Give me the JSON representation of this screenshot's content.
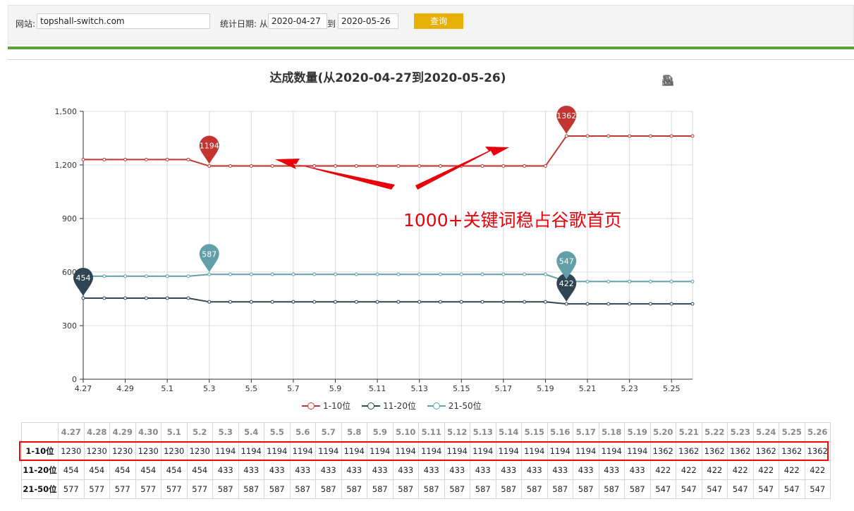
{
  "filter": {
    "site_label": "网站:",
    "site_value": "topshall-switch.com",
    "date_label": "统计日期: 从",
    "date_from": "2020-04-27",
    "to_label": "到",
    "date_to": "2020-05-26",
    "query_label": "查询"
  },
  "annotation_text": "1000+关键词稳占谷歌首页",
  "chart_data": {
    "type": "line",
    "title": "达成数量(从2020-04-27到2020-05-26)",
    "x": [
      "4.27",
      "4.28",
      "4.29",
      "4.30",
      "5.1",
      "5.2",
      "5.3",
      "5.4",
      "5.5",
      "5.6",
      "5.7",
      "5.8",
      "5.9",
      "5.10",
      "5.11",
      "5.12",
      "5.13",
      "5.14",
      "5.15",
      "5.16",
      "5.17",
      "5.18",
      "5.19",
      "5.20",
      "5.21",
      "5.22",
      "5.23",
      "5.24",
      "5.25",
      "5.26"
    ],
    "x_tick_labels": [
      "4.27",
      "4.29",
      "5.1",
      "5.3",
      "5.5",
      "5.7",
      "5.9",
      "5.11",
      "5.13",
      "5.15",
      "5.17",
      "5.19",
      "5.21",
      "5.23",
      "5.25"
    ],
    "y_ticks": [
      "0",
      "300",
      "600",
      "900",
      "1,200",
      "1,500"
    ],
    "ylim": [
      0,
      1500
    ],
    "series": [
      {
        "name": "1-10位",
        "color": "#c23531",
        "values": [
          1230,
          1230,
          1230,
          1230,
          1230,
          1230,
          1194,
          1194,
          1194,
          1194,
          1194,
          1194,
          1194,
          1194,
          1194,
          1194,
          1194,
          1194,
          1194,
          1194,
          1194,
          1194,
          1194,
          1362,
          1362,
          1362,
          1362,
          1362,
          1362,
          1362
        ]
      },
      {
        "name": "11-20位",
        "color": "#2f4554",
        "values": [
          454,
          454,
          454,
          454,
          454,
          454,
          433,
          433,
          433,
          433,
          433,
          433,
          433,
          433,
          433,
          433,
          433,
          433,
          433,
          433,
          433,
          433,
          433,
          422,
          422,
          422,
          422,
          422,
          422,
          422
        ]
      },
      {
        "name": "21-50位",
        "color": "#61a0a8",
        "values": [
          577,
          577,
          577,
          577,
          577,
          577,
          587,
          587,
          587,
          587,
          587,
          587,
          587,
          587,
          587,
          587,
          587,
          587,
          587,
          587,
          587,
          587,
          587,
          547,
          547,
          547,
          547,
          547,
          547,
          547
        ]
      }
    ],
    "markers": [
      {
        "series": 0,
        "index": 6,
        "label": "1194"
      },
      {
        "series": 0,
        "index": 23,
        "label": "1362"
      },
      {
        "series": 1,
        "index": 0,
        "label": "454"
      },
      {
        "series": 1,
        "index": 23,
        "label": "422"
      },
      {
        "series": 2,
        "index": 6,
        "label": "587"
      },
      {
        "series": 2,
        "index": 23,
        "label": "547"
      }
    ],
    "legend_position": "bottom-center",
    "grid": true
  },
  "table": {
    "headers": [
      "4.27",
      "4.28",
      "4.29",
      "4.30",
      "5.1",
      "5.2",
      "5.3",
      "5.4",
      "5.5",
      "5.6",
      "5.7",
      "5.8",
      "5.9",
      "5.10",
      "5.11",
      "5.12",
      "5.13",
      "5.14",
      "5.15",
      "5.16",
      "5.17",
      "5.18",
      "5.19",
      "5.20",
      "5.21",
      "5.22",
      "5.23",
      "5.24",
      "5.25",
      "5.26"
    ],
    "rows": [
      {
        "label": "1-10位",
        "values": [
          "1230",
          "1230",
          "1230",
          "1230",
          "1230",
          "1230",
          "1194",
          "1194",
          "1194",
          "1194",
          "1194",
          "1194",
          "1194",
          "1194",
          "1194",
          "1194",
          "1194",
          "1194",
          "1194",
          "1194",
          "1194",
          "1194",
          "1194",
          "1362",
          "1362",
          "1362",
          "1362",
          "1362",
          "1362",
          "1362"
        ]
      },
      {
        "label": "11-20位",
        "values": [
          "454",
          "454",
          "454",
          "454",
          "454",
          "454",
          "433",
          "433",
          "433",
          "433",
          "433",
          "433",
          "433",
          "433",
          "433",
          "433",
          "433",
          "433",
          "433",
          "433",
          "433",
          "433",
          "433",
          "422",
          "422",
          "422",
          "422",
          "422",
          "422",
          "422"
        ]
      },
      {
        "label": "21-50位",
        "values": [
          "577",
          "577",
          "577",
          "577",
          "577",
          "577",
          "587",
          "587",
          "587",
          "587",
          "587",
          "587",
          "587",
          "587",
          "587",
          "587",
          "587",
          "587",
          "587",
          "587",
          "587",
          "587",
          "587",
          "547",
          "547",
          "547",
          "547",
          "547",
          "547",
          "547"
        ]
      }
    ]
  },
  "toolbox_icons": [
    "data-view-icon",
    "line-chart-icon",
    "bar-chart-icon",
    "restore-icon",
    "download-icon"
  ]
}
